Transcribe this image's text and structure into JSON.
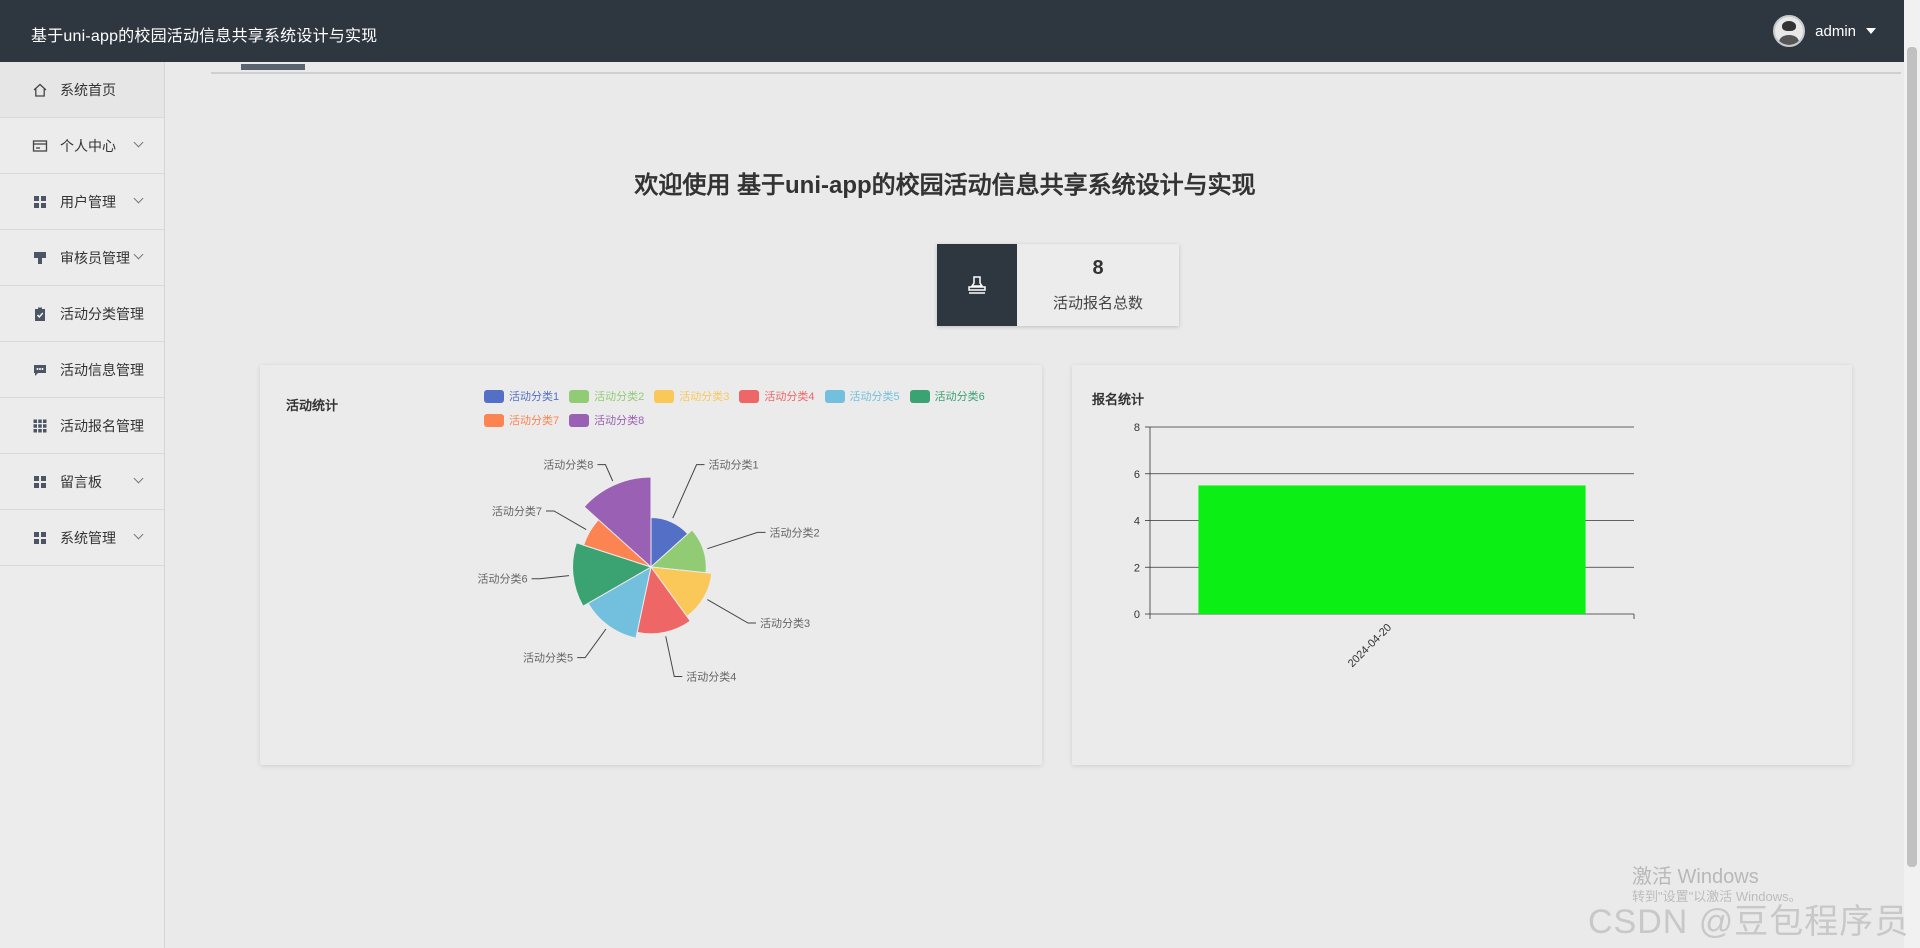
{
  "header": {
    "title": "基于uni-app的校园活动信息共享系统设计与实现",
    "user_name": "admin"
  },
  "sidebar": {
    "items": [
      {
        "label": "系统首页",
        "icon": "home-icon",
        "has_submenu": false
      },
      {
        "label": "个人中心",
        "icon": "card-icon",
        "has_submenu": true
      },
      {
        "label": "用户管理",
        "icon": "grid-icon",
        "has_submenu": true
      },
      {
        "label": "审核员管理",
        "icon": "stamp-icon",
        "has_submenu": true
      },
      {
        "label": "活动分类管理",
        "icon": "clipboard-icon",
        "has_submenu": false
      },
      {
        "label": "活动信息管理",
        "icon": "message-icon",
        "has_submenu": false
      },
      {
        "label": "活动报名管理",
        "icon": "apps-icon",
        "has_submenu": false
      },
      {
        "label": "留言板",
        "icon": "grid-icon",
        "has_submenu": true
      },
      {
        "label": "系统管理",
        "icon": "grid-icon",
        "has_submenu": true
      }
    ]
  },
  "main": {
    "welcome": "欢迎使用 基于uni-app的校园活动信息共享系统设计与实现",
    "stat": {
      "value": "8",
      "label": "活动报名总数",
      "icon": "stamp-icon"
    },
    "activity_card": {
      "title": "活动统计"
    },
    "signup_card": {
      "title": "报名统计"
    }
  },
  "chart_data": [
    {
      "type": "pie",
      "subtype": "rose",
      "title": "活动统计",
      "legend_position": "top-right",
      "categories": [
        "活动分类1",
        "活动分类2",
        "活动分类3",
        "活动分类4",
        "活动分类5",
        "活动分类6",
        "活动分类7",
        "活动分类8"
      ],
      "values": [
        1,
        1,
        1,
        1,
        1,
        1,
        0.5,
        1
      ],
      "colors": [
        "#5470c6",
        "#91cc75",
        "#fac858",
        "#ee6666",
        "#73c0de",
        "#3ba272",
        "#fc8452",
        "#9a60b4"
      ]
    },
    {
      "type": "bar",
      "title": "报名统计",
      "categories": [
        "2024-04-20"
      ],
      "values": [
        5.5
      ],
      "ylim": [
        0,
        8
      ],
      "yticks": [
        "0",
        "2",
        "4",
        "6",
        "8"
      ],
      "grid": true,
      "bar_color": "#0cef14"
    }
  ],
  "watermarks": {
    "windows_line1": "激活 Windows",
    "windows_line2": "转到\"设置\"以激活 Windows。",
    "csdn": "CSDN @豆包程序员"
  }
}
